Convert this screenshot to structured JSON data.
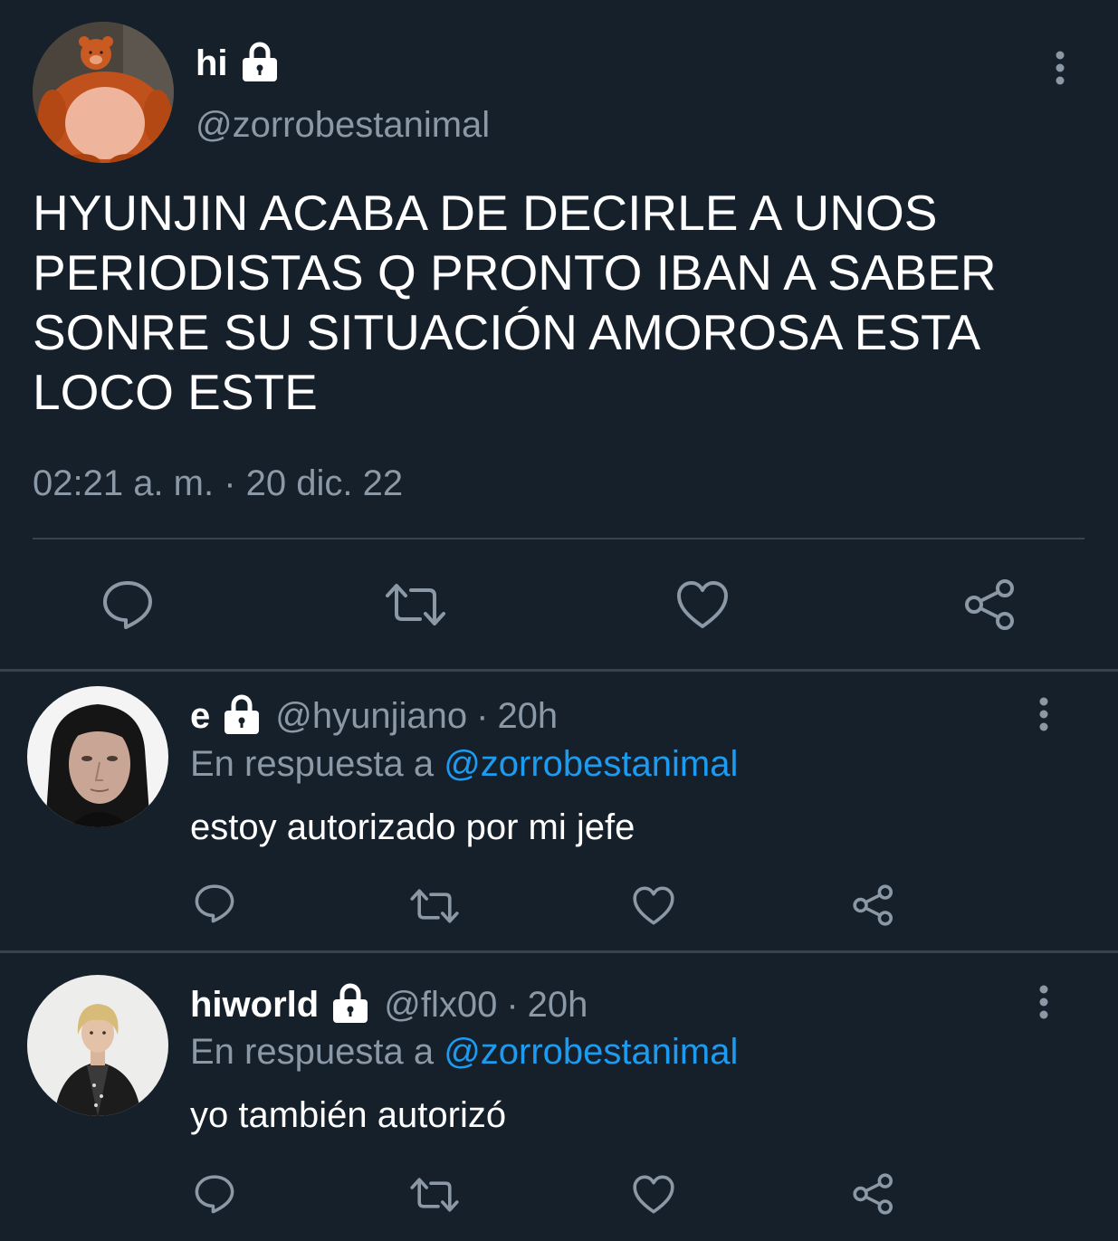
{
  "colors": {
    "background": "#15202b",
    "secondary_text": "#8b98a5",
    "mention": "#1d9bf0",
    "divider": "#38444d"
  },
  "main_tweet": {
    "display_name": "hi",
    "handle": "@zorrobestanimal",
    "text": "HYUNJIN ACABA DE DECIRLE A UNOS PERIODISTAS Q PRONTO IBAN A SABER SONRE SU SITUACIÓN AMOROSA ESTA LOCO ESTE",
    "timestamp": "02:21 a. m. · 20 dic. 22",
    "icons": [
      "lock-icon",
      "more-vertical-icon",
      "reply-icon",
      "retweet-icon",
      "like-icon",
      "share-icon"
    ]
  },
  "replies": [
    {
      "display_name": "e",
      "handle": "@hyunjiano",
      "separator": "·",
      "time": "20h",
      "reply_prefix": "En respuesta a",
      "reply_to": "@zorrobestanimal",
      "text": "estoy autorizado por mi jefe"
    },
    {
      "display_name": "hiworld",
      "handle": "@flx00",
      "separator": "·",
      "time": "20h",
      "reply_prefix": "En respuesta a",
      "reply_to": "@zorrobestanimal",
      "text": "yo también autorizó"
    }
  ]
}
